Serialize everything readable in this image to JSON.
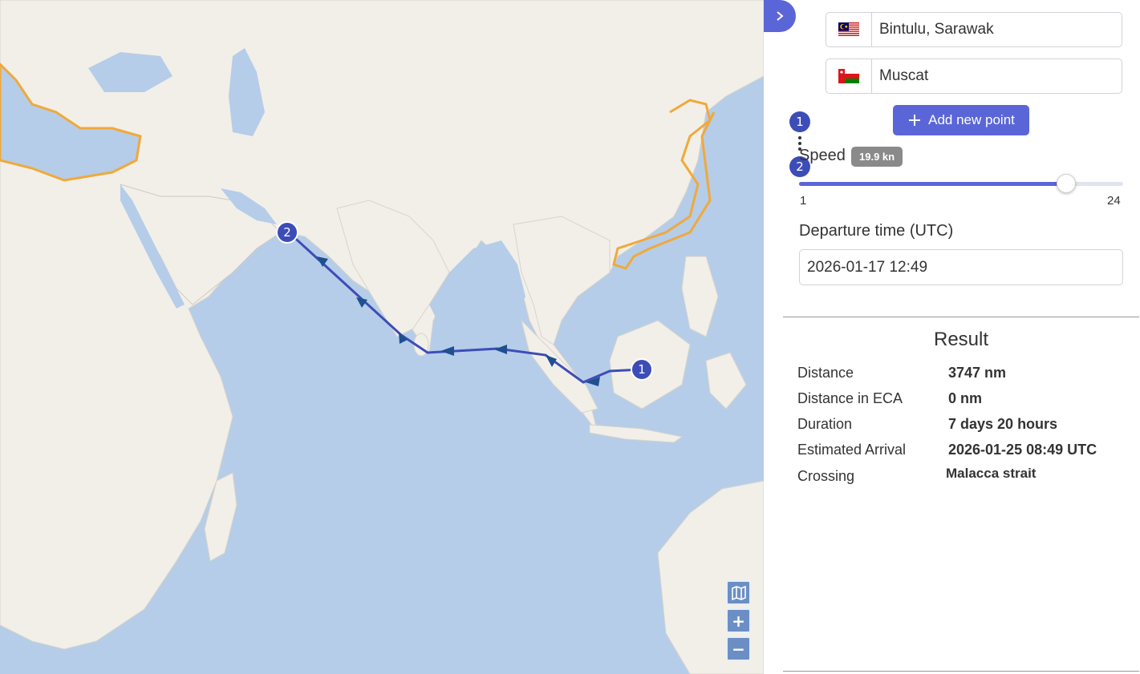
{
  "map": {
    "markers": [
      {
        "label": "1"
      },
      {
        "label": "2"
      }
    ],
    "controls": {
      "zoom_in": "+",
      "zoom_out": "−"
    },
    "colors": {
      "sea": "#b5cde8",
      "land": "#f2efe9",
      "route": "#3d4db7",
      "eca_border": "#f0a93a"
    }
  },
  "points": [
    {
      "flag": "MY",
      "name": "Bintulu, Sarawak"
    },
    {
      "flag": "OM",
      "name": "Muscat"
    }
  ],
  "add_point_label": "Add new point",
  "order_badges": [
    "1",
    "2"
  ],
  "speed": {
    "label": "Speed",
    "value_label": "19.9 kn",
    "min": "1",
    "max": "24",
    "value": 19.9
  },
  "departure": {
    "label": "Departure time (UTC)",
    "value": "2026-01-17 12:49"
  },
  "result": {
    "title": "Result",
    "rows": [
      {
        "label": "Distance",
        "value": "3747 nm"
      },
      {
        "label": "Distance in ECA",
        "value": "0 nm"
      },
      {
        "label": "Duration",
        "value": "7 days 20 hours"
      },
      {
        "label": "Estimated Arrival",
        "value": "2026-01-25 08:49 UTC"
      },
      {
        "label": "Crossing",
        "value": "Malacca strait"
      }
    ]
  }
}
